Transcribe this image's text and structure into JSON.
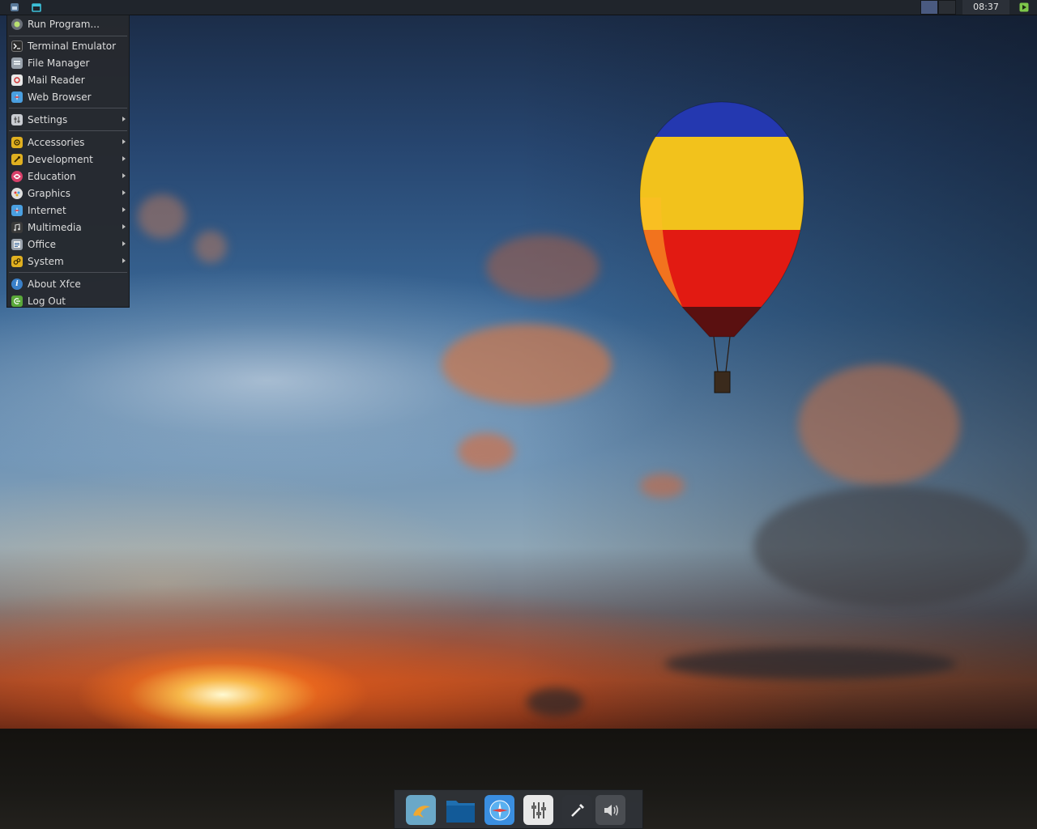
{
  "top_panel": {
    "clock": "08:37",
    "launchers": [
      "apps-menu-icon",
      "window-icon"
    ],
    "workspaces": [
      {
        "active": true,
        "color": "#4a5a80"
      },
      {
        "active": false,
        "color": "#2a2e34"
      }
    ],
    "tray": {
      "icon": "power-manager-icon",
      "color": "#7ec84a"
    }
  },
  "app_menu": {
    "items": [
      {
        "label": "Run Program...",
        "icon": "run-program-icon",
        "color": "#6a6f78",
        "submenu": false
      },
      {
        "label": "Terminal Emulator",
        "icon": "terminal-icon",
        "color": "#2b2b2b",
        "submenu": false
      },
      {
        "label": "File Manager",
        "icon": "file-manager-icon",
        "color": "#9aa3ad",
        "submenu": false
      },
      {
        "label": "Mail Reader",
        "icon": "mail-icon",
        "color": "#e8e8e8",
        "submenu": false
      },
      {
        "label": "Web Browser",
        "icon": "web-browser-icon",
        "color": "#4a9fe0",
        "submenu": false
      },
      {
        "label": "Settings",
        "icon": "settings-icon",
        "color": "#c9ccd1",
        "submenu": true
      },
      {
        "label": "Accessories",
        "icon": "accessories-icon",
        "color": "#e0b020",
        "submenu": true
      },
      {
        "label": "Development",
        "icon": "development-icon",
        "color": "#e0b020",
        "submenu": true
      },
      {
        "label": "Education",
        "icon": "education-icon",
        "color": "#d8406a",
        "submenu": true
      },
      {
        "label": "Graphics",
        "icon": "graphics-icon",
        "color": "#e07030",
        "submenu": true
      },
      {
        "label": "Internet",
        "icon": "internet-icon",
        "color": "#4a9fe0",
        "submenu": true
      },
      {
        "label": "Multimedia",
        "icon": "multimedia-icon",
        "color": "#3a3a3a",
        "submenu": true
      },
      {
        "label": "Office",
        "icon": "office-icon",
        "color": "#9aa3ad",
        "submenu": true
      },
      {
        "label": "System",
        "icon": "system-icon",
        "color": "#e0b020",
        "submenu": true
      },
      {
        "label": "About Xfce",
        "icon": "info-icon",
        "color": "#3a80c8",
        "submenu": false
      },
      {
        "label": "Log Out",
        "icon": "logout-icon",
        "color": "#5aa83a",
        "submenu": false
      }
    ]
  },
  "dock": {
    "items": [
      {
        "name": "dolphin-icon",
        "color": "#6aa8c8"
      },
      {
        "name": "folder-icon",
        "color": "#1f6fb0"
      },
      {
        "name": "compass-browser-icon",
        "color": "#3a8ee0"
      },
      {
        "name": "settings-panel-icon",
        "color": "#e8e8e8"
      },
      {
        "name": "color-picker-icon",
        "color": "#2f3237"
      },
      {
        "name": "volume-icon",
        "color": "#4a4d52"
      }
    ]
  }
}
